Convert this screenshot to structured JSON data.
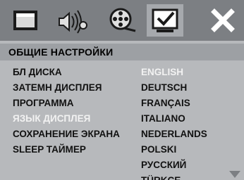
{
  "tabs": [
    {
      "name": "general-setup",
      "icon": "monitor-icon"
    },
    {
      "name": "audio-setup",
      "icon": "speaker-icon"
    },
    {
      "name": "video-setup",
      "icon": "video-reel-icon"
    },
    {
      "name": "preference",
      "icon": "checkmark-screen-icon",
      "selected": true
    },
    {
      "name": "exit",
      "icon": "close-icon"
    }
  ],
  "section_title": "ОБЩИЕ НАСТРОЙКИ",
  "menu": {
    "items": [
      "БЛ ДИСКА",
      "ЗАТЕМН ДИСПЛЕЯ",
      "ПРОГРАММА",
      "ЯЗЫК ДИСПЛЕЯ",
      "СОХРАНЕНИЕ ЭКРАНА",
      "SLEEP ТАЙМЕР"
    ],
    "active_index": 3
  },
  "options": {
    "items": [
      "ENGLISH",
      "DEUTSCH",
      "FRANÇAIS",
      "ITALIANO",
      "NEDERLANDS",
      "POLSKI",
      "РУССКИЙ",
      "TÜRKCE"
    ],
    "selected_index": 0
  },
  "colors": {
    "background": "#b7b9bc",
    "icon_bar": "#7c7f83",
    "highlight_text": "#f2f2f2",
    "text": "#111111"
  }
}
